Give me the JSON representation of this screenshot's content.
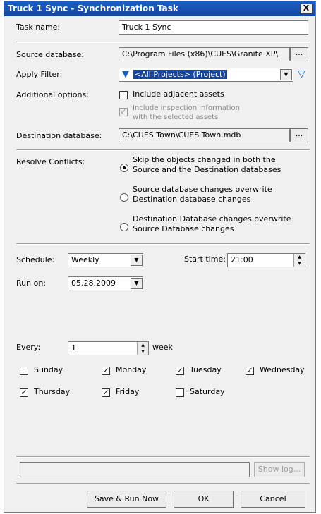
{
  "window": {
    "title": "Truck 1 Sync - Synchronization Task",
    "close_label": "X"
  },
  "task": {
    "label": "Task name:",
    "value": "Truck 1 Sync"
  },
  "source": {
    "label": "Source database:",
    "value": "C:\\Program Files (x86)\\CUES\\Granite XP\\",
    "browse_label": "..."
  },
  "filter": {
    "label": "Apply Filter:",
    "value": "<All Projects> (Project)"
  },
  "options": {
    "label": "Additional options:",
    "include_adjacent": {
      "label": "Include adjacent assets",
      "checked": false
    },
    "include_inspection": {
      "label_line1": "Include inspection information",
      "label_line2": "with the selected assets",
      "checked": true,
      "enabled": false
    }
  },
  "destination": {
    "label": "Destination database:",
    "value": "C:\\CUES Town\\CUES Town.mdb",
    "browse_label": "..."
  },
  "conflicts": {
    "label": "Resolve Conflicts:",
    "options": [
      {
        "line1": "Skip the objects changed in both the",
        "line2": "Source and the Destination databases",
        "selected": true
      },
      {
        "line1": "Source database changes overwrite",
        "line2": "Destination database changes",
        "selected": false
      },
      {
        "line1": "Destination Database changes overwrite",
        "line2": "Source Database changes",
        "selected": false
      }
    ]
  },
  "schedule": {
    "label": "Schedule:",
    "value": "Weekly",
    "start_label": "Start time:",
    "start_value": "21:00",
    "run_on_label": "Run on:",
    "run_on_value": "05.28.2009",
    "every_label": "Every:",
    "every_value": "1",
    "every_unit": "week"
  },
  "days": [
    {
      "label": "Sunday",
      "checked": false
    },
    {
      "label": "Monday",
      "checked": true
    },
    {
      "label": "Tuesday",
      "checked": true
    },
    {
      "label": "Wednesday",
      "checked": true
    },
    {
      "label": "Thursday",
      "checked": true
    },
    {
      "label": "Friday",
      "checked": true
    },
    {
      "label": "Saturday",
      "checked": false
    }
  ],
  "footer": {
    "show_log_label": "Show log...",
    "save_run_label": "Save & Run Now",
    "ok_label": "OK",
    "cancel_label": "Cancel"
  }
}
